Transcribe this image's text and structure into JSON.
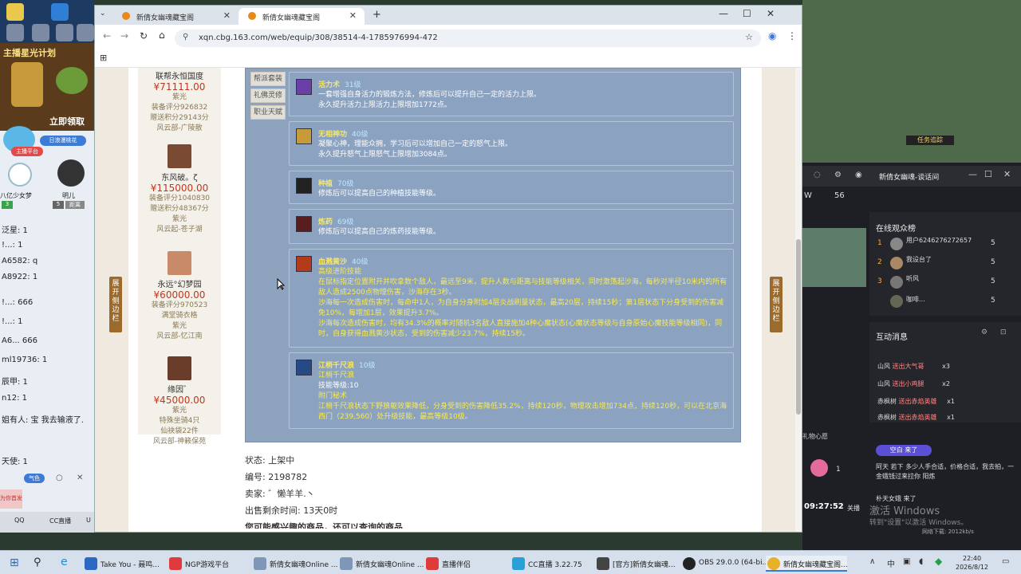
{
  "browser": {
    "tabs": [
      {
        "title": "新倩女幽魂藏宝阁",
        "active": false
      },
      {
        "title": "新倩女幽魂藏宝阁",
        "active": true
      }
    ],
    "url": "xqn.cbg.163.com/web/equip/308/38514-4-1785976994-472"
  },
  "left_panel": {
    "banner1": "主播星光计划",
    "banner2": "立即领取",
    "badge": "日浪漫桃花",
    "badge2": "主播平台",
    "chat_user1": "八亿少女梦",
    "chat_user2": "明儿",
    "level1": "3",
    "level2": "5",
    "level_tag": "距离",
    "chat_lines": [
      "泛星: 1",
      "!...: 1",
      "A6582: q",
      "A8922: 1",
      "!...: 666",
      "!...: 1",
      "A6... 666",
      "ml19736: 1",
      "辰甲: 1",
      "n12: 1",
      "姐有人: 宝 我去输液了.",
      "天使: 1"
    ],
    "bottom_labels": [
      "QQ",
      "CC直播",
      "U"
    ],
    "gift_label": "为你首发",
    "pill": "气色"
  },
  "sellers": [
    {
      "name": "联帮永恒国度",
      "price": "¥71111.00",
      "lines": [
        "紫光",
        "装备评分926832",
        "赠送积分29143分",
        "风云部-广陵散"
      ]
    },
    {
      "name": "东风破。ζ",
      "price": "¥115000.00",
      "lines": [
        "装备评分1040830",
        "赠送积分48367分",
        "紫光",
        "风云起-苍子湖"
      ]
    },
    {
      "name": "永远°幻梦园",
      "price": "¥60000.00",
      "lines": [
        "装备评分970523",
        "满堂骑衣格",
        "紫光",
        "风云部-忆江南"
      ]
    },
    {
      "name": "缘因゛",
      "price": "¥45000.00",
      "lines": [
        "紫光",
        "特殊坐骑4只",
        "仙袂袋22件",
        "风云部-神籁保苑"
      ]
    }
  ],
  "side_tabs": [
    "帮派套装",
    "礼佛灵修",
    "职业天赋"
  ],
  "skills": [
    {
      "name": "活力术",
      "level": "31级",
      "lines": [
        {
          "t": "一套增强自身活力的锻炼方法，修炼后可以提升自己一定的活力上限。"
        },
        {
          "t": "永久提升活力上限活力上限增加1772点。"
        }
      ]
    },
    {
      "name": "无相神功",
      "level": "40级",
      "lines": [
        {
          "t": "凝聚心神，理能众拥，学习后可以增加自己一定的怒气上限。"
        },
        {
          "t": "永久提升怒气上限怒气上限增加3084点。"
        }
      ]
    },
    {
      "name": "种植",
      "level": "70级",
      "lines": [
        {
          "t": "修炼后可以提高自己的种植技能等级。"
        }
      ]
    },
    {
      "name": "炼药",
      "level": "69级",
      "lines": [
        {
          "t": "修炼后可以提高自己的炼药技能等级。"
        }
      ]
    },
    {
      "name": "血溅黄沙",
      "level": "40级",
      "lines": [
        {
          "t": "高级进阶技能",
          "y": true
        },
        {
          "t": "在鼠标指定位置附开并吹拿数个敌人，最远至9米，提升人数与距离与技能等级相关，同时激荡起沙海，每秒对半径10米内的所有敌人造成2500点物理伤害，沙海存在3秒。",
          "y": true
        },
        {
          "t": "沙海每一次造成伤害时，每命中1人，为自身分身附加4层炎战刷量状态，最高20层，持续15秒；第1层状态下分身受到的伤害减免10%，每增加1层，效果提升3.7%。",
          "y": true
        },
        {
          "t": "沙海每次造成伤害时，均有34.3%的概率对随机3名敌人直接施加4种心魔状态(心魔状态等级与自身原始心魔技能等级相同)，同时，自身获得血溅黄沙状态，受到的伤害减少23.7%，持续15秒。",
          "y": true
        }
      ]
    },
    {
      "name": "江梢千尺浪",
      "level": "10级",
      "lines": [
        {
          "t": "江梢千尺浪",
          "y": true
        },
        {
          "t": "技能等级:10"
        },
        {
          "t": "附门秘术",
          "y": true
        },
        {
          "t": "江梢千尺浪状态下野狼躯效果降低，分身受到的伤害降低35.2%，持续120秒，物理攻击增加734点，持续120秒，可以在北京海西门（239,560）处升级技能，最高等级10级。",
          "y": true
        }
      ]
    }
  ],
  "info": {
    "status_label": "状态:",
    "status_value": "上架中",
    "id_label": "编号:",
    "id_value": "2198782",
    "seller_label": "卖家:",
    "seller_value": "゛懒羊羊.丶",
    "time_label": "出售剩余时间:",
    "time_value": "13天0时",
    "cut_line": "您可能感兴趣的商品，还可以查询的商品..."
  },
  "edge_buttons": {
    "left": "展开侧边栏",
    "right": "展开侧边栏"
  },
  "right_panel": {
    "window_title": "新倩女幽魂-谈话间",
    "online_header": "在线观众榜",
    "viewers": [
      {
        "rank": "1",
        "name": "用户6246276272657",
        "count": "5"
      },
      {
        "rank": "2",
        "name": "我设台了",
        "count": "5"
      },
      {
        "rank": "3",
        "name": "听风",
        "count": "5"
      },
      {
        "rank": "",
        "name": "咖啡...",
        "count": "5"
      }
    ],
    "mid_label": "W",
    "mid_num": "56",
    "interact_header": "互动消息",
    "gift_rows": [
      {
        "user": "山风",
        "action": "送出大气哥",
        "count": "x3"
      },
      {
        "user": "山风",
        "action": "送出小鸡腿",
        "count": "x2"
      },
      {
        "user": "赤枫树",
        "action": "送出赤焰英雄",
        "count": "x1"
      },
      {
        "user": "赤枫树",
        "action": "送出赤焰英雄",
        "count": "x1"
      }
    ],
    "chat1": "空白 来了",
    "chat2": "阿天 若下 多少人手合适，价格合适，我去拍，一金蛾钱过来拉你 阳炼",
    "chat3": "朴天女蛾 来了",
    "time": "09:27:52",
    "time_suffix": "关播",
    "net": "网络下载: 2012kb/s",
    "watermark1": "激活 Windows",
    "watermark2": "转到\"设置\"以激活 Windows。",
    "gift_panel_label": "礼物心愿",
    "gift_count": "1"
  },
  "taskbar": {
    "items": [
      "Take You - 聂鸣...",
      "NGP游戏平台",
      "新倩女幽魂Online ...",
      "新倩女幽魂Online ...",
      "直播伴侣",
      "CC直播 3.22.75",
      "[官方]新倩女幽魂...",
      "OBS 29.0.0 (64-bi...",
      "新倩女幽魂藏宝阁..."
    ],
    "tray_ime": "中",
    "clock_time": "22:40",
    "clock_date": "2026/8/12"
  },
  "colors": {
    "panel": "#8ea3be",
    "price": "#c4361b",
    "skill_title": "#f6e76a",
    "skill_level": "#bfe8ff",
    "accent": "#3b78d8"
  }
}
